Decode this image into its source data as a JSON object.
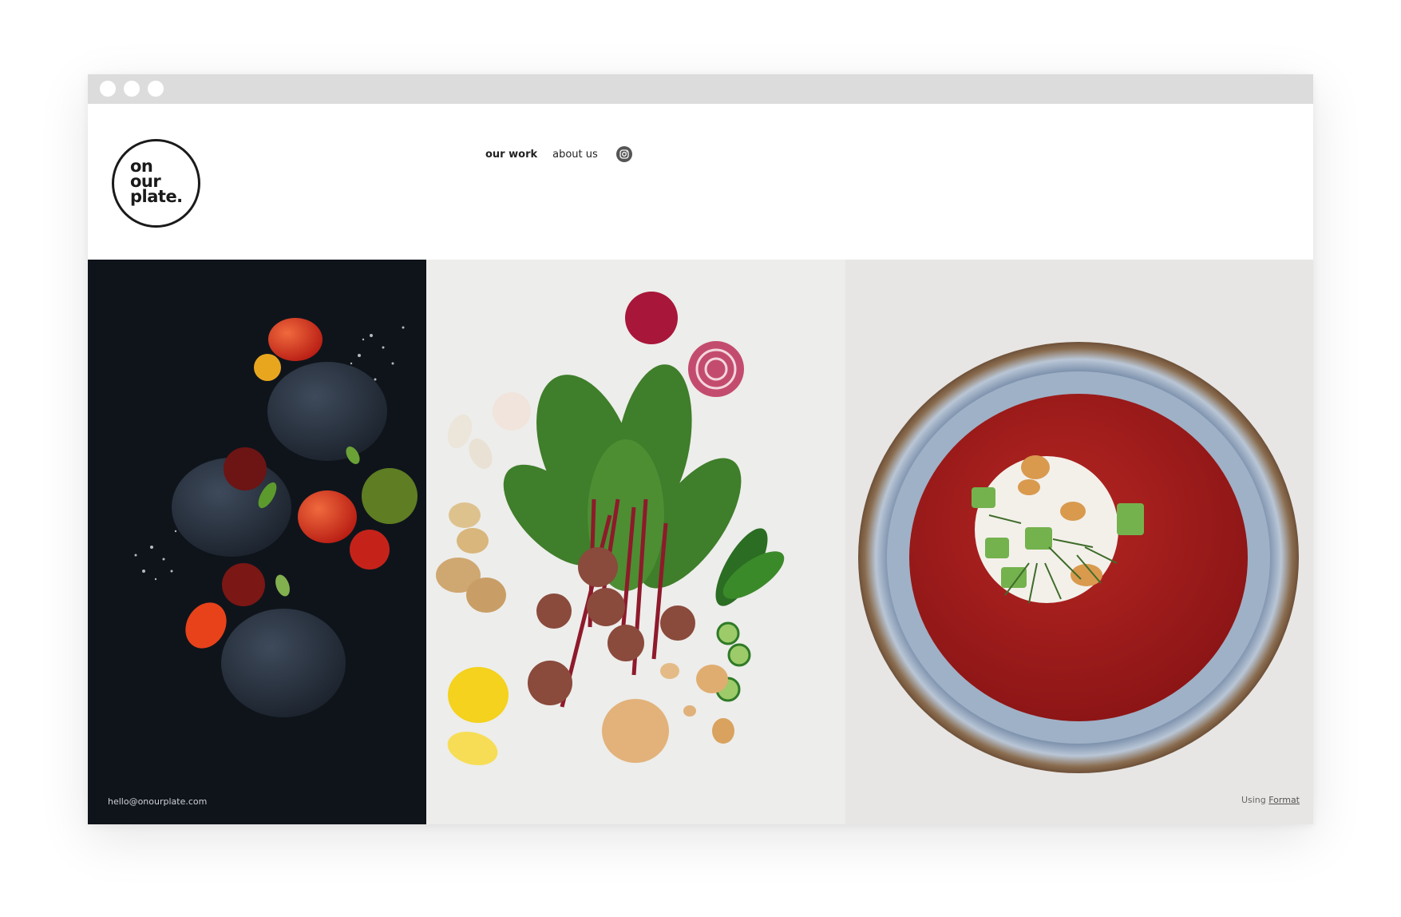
{
  "logo": {
    "lines": "on\nour\nplate."
  },
  "nav": {
    "items": [
      {
        "label": "our work",
        "active": true
      },
      {
        "label": "about us",
        "active": false
      }
    ],
    "instagram_icon": "instagram-icon"
  },
  "gallery": {
    "images": [
      {
        "alt": "stones-and-tomatoes-photo"
      },
      {
        "alt": "beetroot-and-vegetables-photo"
      },
      {
        "alt": "beet-soup-bowl-photo"
      }
    ]
  },
  "footer": {
    "email": "hello@onourplate.com",
    "credit_prefix": "Using",
    "credit_link": "Format"
  },
  "colors": {
    "chrome": "#dcdcdc",
    "dark_panel": "#0f141b",
    "soup": "#a51d1c"
  }
}
